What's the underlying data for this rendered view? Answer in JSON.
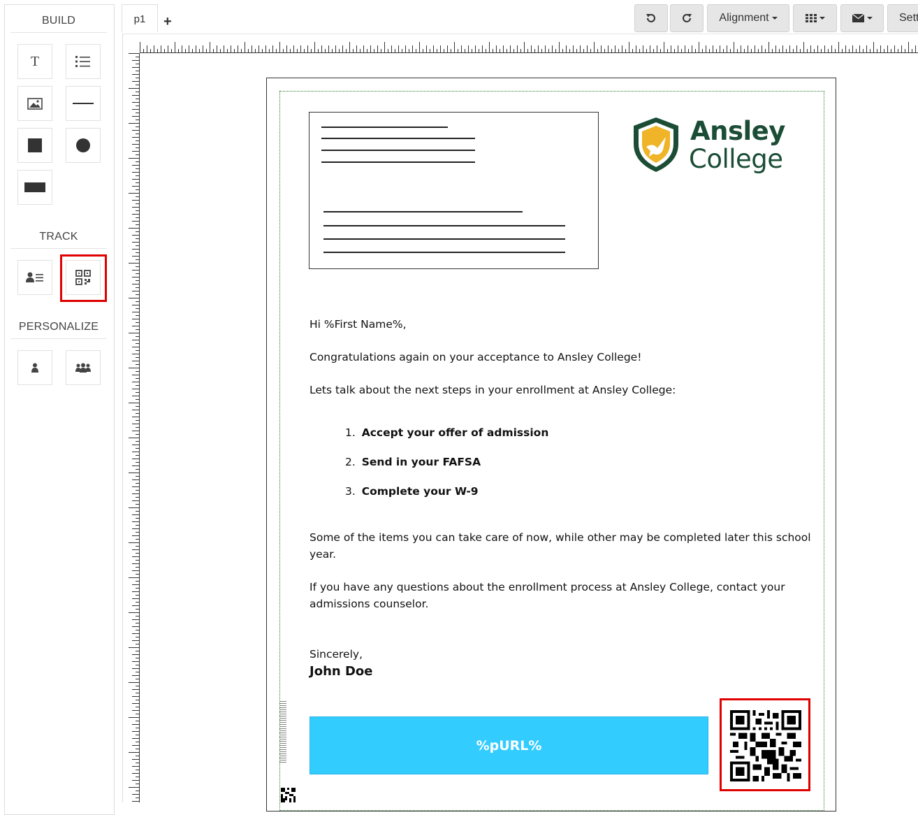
{
  "sidebar": {
    "build_title": "BUILD",
    "track_title": "TRACK",
    "personalize_title": "PERSONALIZE",
    "build_tools": [
      "text-tool",
      "list-tool",
      "image-tool",
      "line-tool",
      "square-tool",
      "circle-tool",
      "rectangle-tool"
    ],
    "track_tools": [
      "contact-field-tool",
      "qr-code-tool"
    ],
    "personalize_tools": [
      "single-person-tool",
      "group-tool"
    ]
  },
  "tabs": {
    "page1": "p1",
    "add": "+"
  },
  "toolbar": {
    "alignment_label": "Alignment",
    "settings_label": "Sett"
  },
  "letter": {
    "greeting": "Hi %First Name%,",
    "congrats": "Congratulations again on your acceptance to Ansley College!",
    "next_steps": "Lets talk about the next steps in your enrollment at Ansley College:",
    "steps": [
      {
        "num": "1.",
        "text": "Accept your offer of admission"
      },
      {
        "num": "2.",
        "text": "Send in your FAFSA"
      },
      {
        "num": "3.",
        "text": "Complete your W-9"
      }
    ],
    "para1_line1": "Some of the items you can take care of now, while other may be completed later this school",
    "para1_line2": "year.",
    "para2_line1": "If you have any questions about the enrollment process at Ansley College, contact your",
    "para2_line2": "admissions counselor.",
    "closing": "Sincerely,",
    "signature": "John Doe"
  },
  "logo": {
    "line1": "Ansley",
    "line2": "College",
    "brand_color": "#1b4d36",
    "shield_accent": "#f0b429"
  },
  "purl": {
    "label": "%pURL%",
    "color": "#33ccff"
  },
  "highlight_color": "#e00000"
}
